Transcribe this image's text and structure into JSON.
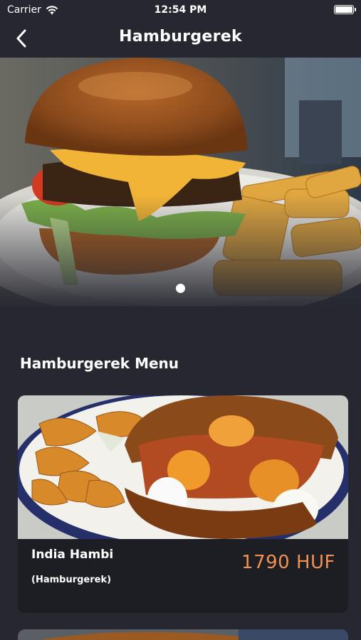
{
  "status_bar": {
    "carrier": "Carrier",
    "time": "12:54 PM"
  },
  "nav": {
    "title": "Hamburgerek",
    "back_icon": "chevron-left-icon"
  },
  "carousel": {
    "page_count": 1,
    "active_page": 1
  },
  "section": {
    "title": "Hamburgerek Menu"
  },
  "menu_items": [
    {
      "name": "India Hambi",
      "category": "(Hamburgerek)",
      "price": "1790 HUF"
    }
  ],
  "colors": {
    "background": "#262730",
    "card": "#1d1e24",
    "price": "#f0914f"
  }
}
